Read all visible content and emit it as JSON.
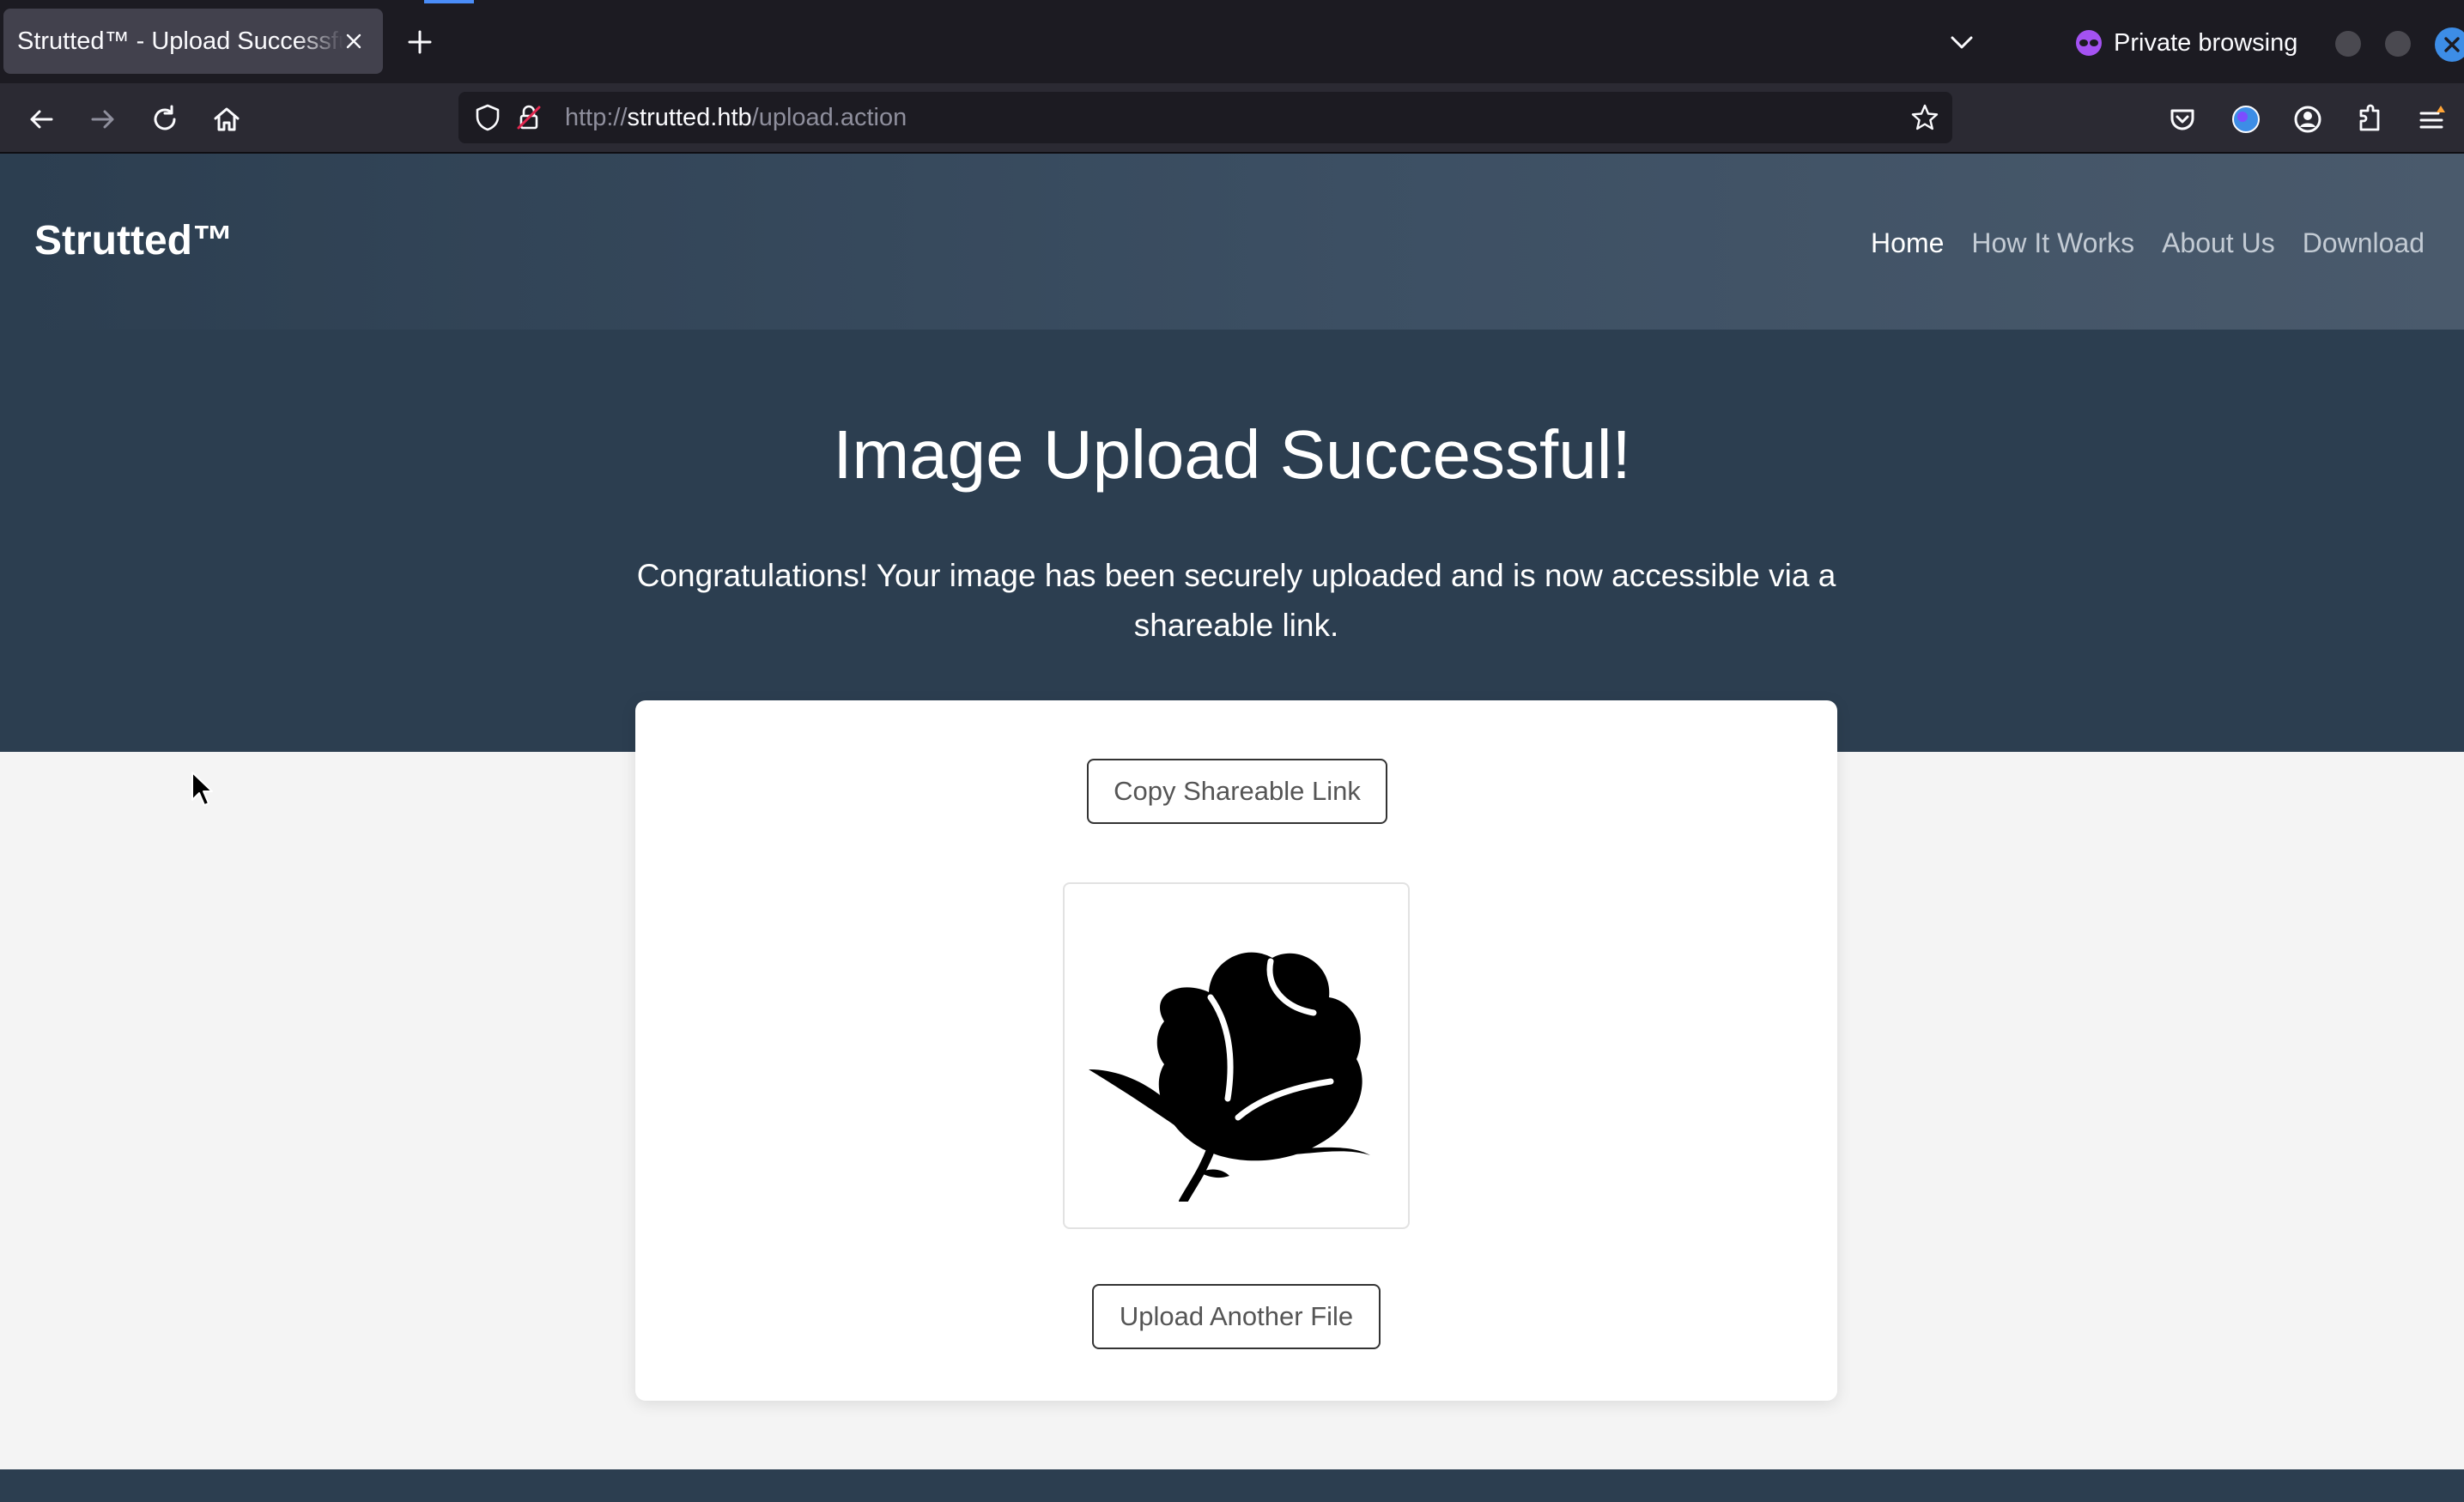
{
  "browser": {
    "tab_title": "Strutted™ - Upload Successful",
    "private_label": "Private browsing",
    "url_host": "strutted.htb",
    "url_scheme": "http://",
    "url_path": "/upload.action"
  },
  "site": {
    "brand": "Strutted™",
    "nav": [
      {
        "label": "Home",
        "active": true
      },
      {
        "label": "How It Works"
      },
      {
        "label": "About Us"
      },
      {
        "label": "Download"
      }
    ]
  },
  "hero": {
    "title": "Image Upload Successful!",
    "subtitle": "Congratulations! Your image has been securely uploaded and is now accessible via a shareable link."
  },
  "card": {
    "copy_label": "Copy Shareable Link",
    "upload_label": "Upload Another File",
    "image_icon": "rose-icon"
  },
  "colors": {
    "header_bg": "#2c3e50",
    "accent_blue": "#3d8de6",
    "page_bg": "#f4f4f4"
  }
}
